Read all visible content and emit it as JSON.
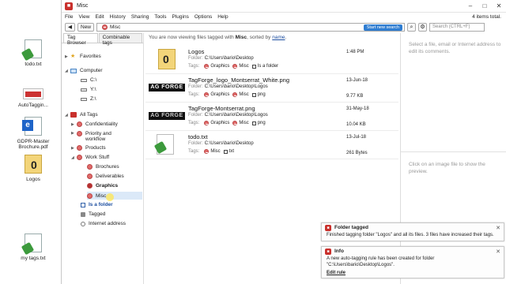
{
  "desktop": {
    "icons": [
      {
        "label": "todo.txt",
        "icon": "text-file-icon"
      },
      {
        "label": "AutoTaggin...",
        "icon": "shortcut-icon"
      },
      {
        "label": "GDPR-Master Brochure.pdf",
        "icon": "pdf-file-icon"
      },
      {
        "label": "Logos",
        "icon": "folder-icon"
      },
      {
        "label": "my tags.txt",
        "icon": "text-file-icon"
      }
    ]
  },
  "window": {
    "title": "Misc",
    "minimize": "–",
    "maximize": "□",
    "close": "✕"
  },
  "menu": {
    "items": [
      "File",
      "View",
      "Edit",
      "History",
      "Sharing",
      "Tools",
      "Plugins",
      "Options",
      "Help"
    ],
    "items_total": "4 items total."
  },
  "toolbar": {
    "back": "◀",
    "new_label": "New",
    "breadcrumb_tag": "Misc",
    "start_search": "Start new search",
    "search_placeholder": "Search (CTRL+F)"
  },
  "tabs": [
    "Tag Browser",
    "Combinable tags"
  ],
  "tree": {
    "favorites": "Favorites",
    "computer": "Computer",
    "drives": [
      "C:\\",
      "Y:\\",
      "Z:\\"
    ],
    "all_tags": "All Tags",
    "confidentiality": "Confidentiality",
    "priority": "Priority and workflow",
    "products": "Products",
    "work_stuff": "Work Stuff",
    "brochures": "Brochures",
    "deliverables": "Deliverables",
    "graphics": "Graphics",
    "misc": "Misc",
    "is_folder": "Is a folder",
    "tagged": "Tagged",
    "internet": "Internet address"
  },
  "center": {
    "viewing_prefix": "You are now viewing files tagged with",
    "viewing_tag": "Misc",
    "viewing_mid": ", sorted by",
    "viewing_sort": "name",
    "files": [
      {
        "name": "Logos",
        "folder_label": "Folder:",
        "folder": "C:\\Users\\bario\\Desktop",
        "tags_label": "Tags:",
        "tags": [
          "Graphics",
          "Misc",
          "Is a folder"
        ],
        "date": "1:48 PM",
        "size": ""
      },
      {
        "name": "TagForge_logo_Montserrat_White.png",
        "folder_label": "Folder:",
        "folder": "C:\\Users\\bario\\Desktop\\Logos",
        "tags_label": "Tags:",
        "tags": [
          "Graphics",
          "Misc",
          "png"
        ],
        "date": "13-Jun-18",
        "size": "9.77 KB"
      },
      {
        "name": "TagForge-Montserrat.png",
        "folder_label": "Folder:",
        "folder": "C:\\Users\\bario\\Desktop\\Logos",
        "tags_label": "Tags:",
        "tags": [
          "Graphics",
          "Misc",
          "png"
        ],
        "date": "31-May-18",
        "size": "10.04 KB"
      },
      {
        "name": "todo.txt",
        "folder_label": "Folder:",
        "folder": "C:\\Users\\bario\\Desktop",
        "tags_label": "Tags:",
        "tags": [
          "Misc",
          "txt"
        ],
        "date": "13-Jul-18",
        "size": "261 Bytes"
      }
    ],
    "thumb_text": "AG FORGE"
  },
  "right": {
    "hint_top": "Select a file, email or Internet address to edit its comments.",
    "hint_bottom": "Click on an image file to show the preview."
  },
  "notifications": [
    {
      "title": "Folder tagged",
      "body": "Finished tagging folder \"Logos\" and all its files. 3 files have increased their tags.",
      "link": ""
    },
    {
      "title": "Info",
      "body": "A new auto-tagging rule has been created for folder \"C:\\Users\\bario\\Desktop\\Logos\".",
      "link": "Edit rule"
    }
  ],
  "colors": {
    "accent": "#c9302c",
    "link": "#1e4fa0",
    "search_button": "#2f7dd1"
  }
}
